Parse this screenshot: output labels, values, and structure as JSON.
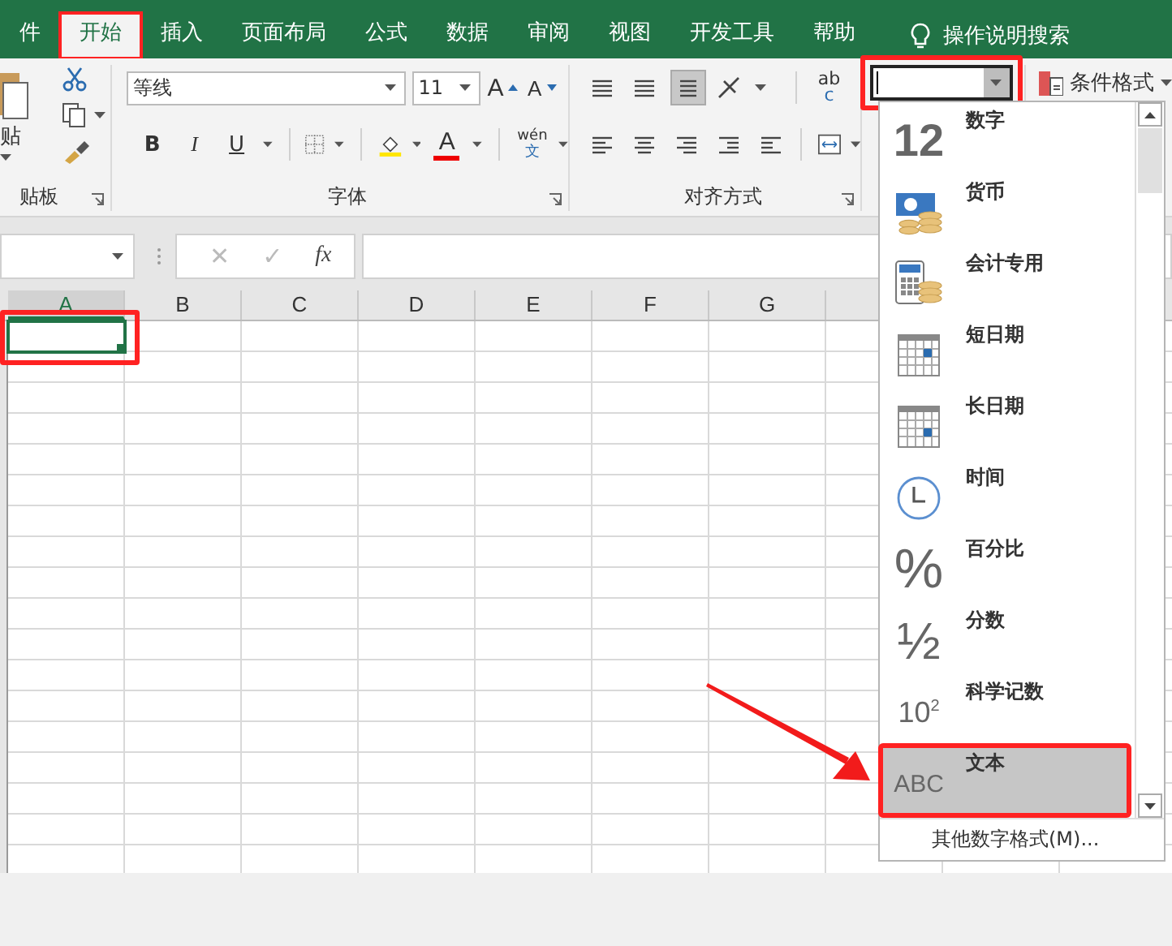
{
  "tabs": [
    {
      "label": "件",
      "selected": false,
      "highlighted": false
    },
    {
      "label": "开始",
      "selected": true,
      "highlighted": true
    },
    {
      "label": "插入",
      "selected": false,
      "highlighted": false
    },
    {
      "label": "页面布局",
      "selected": false,
      "highlighted": false
    },
    {
      "label": "公式",
      "selected": false,
      "highlighted": false
    },
    {
      "label": "数据",
      "selected": false,
      "highlighted": false
    },
    {
      "label": "审阅",
      "selected": false,
      "highlighted": false
    },
    {
      "label": "视图",
      "selected": false,
      "highlighted": false
    },
    {
      "label": "开发工具",
      "selected": false,
      "highlighted": false
    },
    {
      "label": "帮助",
      "selected": false,
      "highlighted": false
    }
  ],
  "tell_me": {
    "label": "操作说明搜索"
  },
  "ribbon": {
    "clipboard": {
      "paste_label": "贴",
      "group_label": "贴板"
    },
    "font": {
      "font_name": "等线",
      "font_size": "11",
      "grow": "A",
      "shrink": "A",
      "styles": [
        "B",
        "I",
        "U"
      ],
      "font_color": "A",
      "phonetic_top": "wén",
      "phonetic_bottom": "文",
      "group_label": "字体"
    },
    "alignment": {
      "wrap_top": "ab",
      "wrap_bottom": "c",
      "group_label": "对齐方式"
    },
    "number": {
      "format_box": {
        "focused": true,
        "highlighted": true
      }
    },
    "conditional_format": "条件格式"
  },
  "formula_bar": {
    "cancel": {
      "label": "✕",
      "disabled": true
    },
    "enter": {
      "label": "✓",
      "disabled": true
    },
    "function_label": "fx"
  },
  "sheet": {
    "columns": [
      {
        "label": "A",
        "selected": true
      },
      {
        "label": "B",
        "selected": false
      },
      {
        "label": "C",
        "selected": false
      },
      {
        "label": "D",
        "selected": false
      },
      {
        "label": "E",
        "selected": false
      },
      {
        "label": "F",
        "selected": false
      },
      {
        "label": "G",
        "selected": false
      }
    ],
    "active_cell": {
      "highlighted": true
    }
  },
  "number_format_menu": {
    "items": [
      {
        "kind": "number",
        "label": "数字",
        "icon_text": "12",
        "selected": false,
        "highlighted": false
      },
      {
        "kind": "currency",
        "label": "货币",
        "selected": false,
        "highlighted": false
      },
      {
        "kind": "accounting",
        "label": "会计专用",
        "selected": false,
        "highlighted": false
      },
      {
        "kind": "short_date",
        "label": "短日期",
        "selected": false,
        "highlighted": false
      },
      {
        "kind": "long_date",
        "label": "长日期",
        "selected": false,
        "highlighted": false
      },
      {
        "kind": "time",
        "label": "时间",
        "selected": false,
        "highlighted": false
      },
      {
        "kind": "percent",
        "label": "百分比",
        "icon_text": "%",
        "selected": false,
        "highlighted": false
      },
      {
        "kind": "fraction",
        "label": "分数",
        "icon_text": "½",
        "selected": false,
        "highlighted": false
      },
      {
        "kind": "scientific",
        "label": "科学记数",
        "icon_text": "10$^{2}$",
        "selected": false,
        "highlighted": false
      },
      {
        "kind": "text",
        "label": "文本",
        "icon_text": "ABC",
        "selected": true,
        "highlighted": true
      }
    ],
    "more": "其他数字格式(M)..."
  },
  "pointer_arrow": true
}
